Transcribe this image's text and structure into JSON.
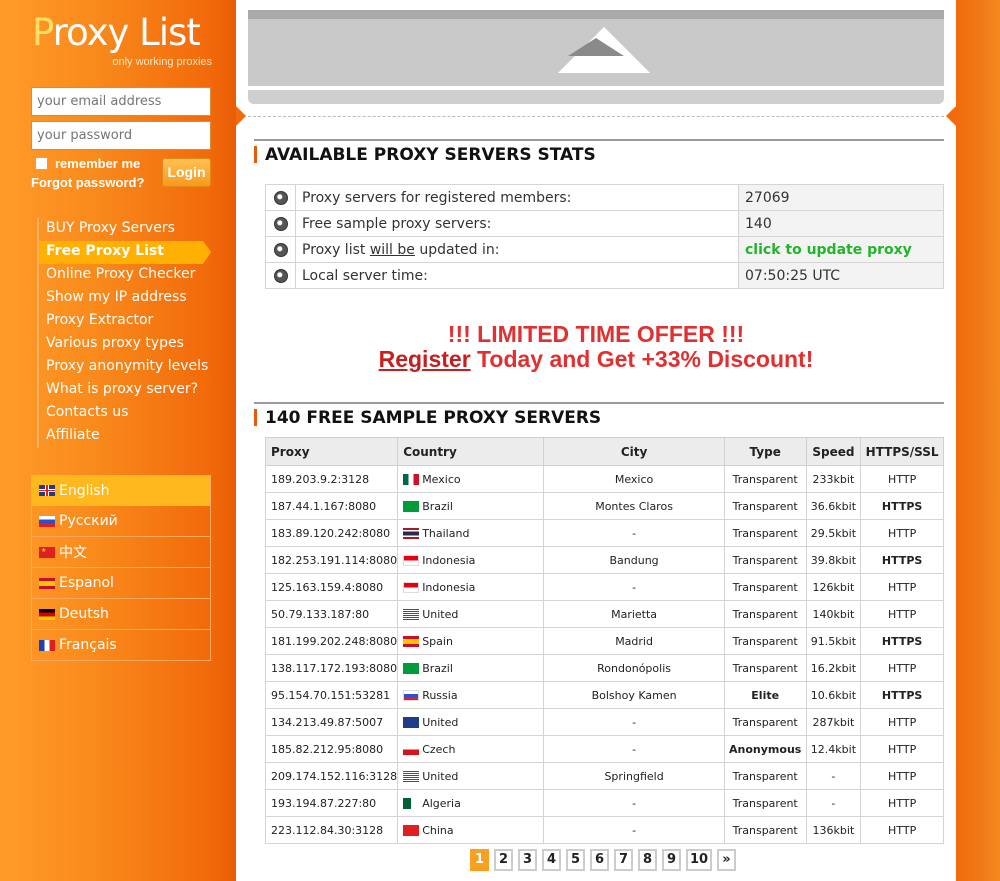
{
  "logo": {
    "first": "P",
    "rest": "roxy List",
    "tagline": "only working proxies"
  },
  "login": {
    "email_placeholder": "your email address",
    "password_placeholder": "your password",
    "remember": "remember me",
    "forgot": "Forgot password?",
    "login_label": "Login"
  },
  "nav": [
    "BUY Proxy Servers",
    "Free Proxy List",
    "Online Proxy Checker",
    "Show my IP address",
    "Proxy Extractor",
    "Various proxy types",
    "Proxy anonymity levels",
    "What is proxy server?",
    "Contacts us",
    "Affiliate"
  ],
  "languages": [
    "English",
    "Русский",
    "中文",
    "Espanol",
    "Deutsh",
    "Français"
  ],
  "stats": {
    "title": "AVAILABLE PROXY SERVERS STATS",
    "rows": [
      {
        "label": "Proxy servers for registered members:",
        "value": "27069"
      },
      {
        "label_pre": "Proxy list ",
        "label_u": "will be",
        "label_post": " updated in:",
        "value": "click to update proxy"
      },
      {
        "label": "Free sample proxy servers:",
        "value": "140"
      },
      {
        "label": "Local server time:",
        "value": "07:50:25 UTC"
      }
    ]
  },
  "offer": {
    "line1": "!!! LIMITED TIME OFFER !!!",
    "register": "Register",
    "line2_rest": " Today and Get +33% Discount!"
  },
  "proxies": {
    "title": "140 FREE SAMPLE PROXY SERVERS",
    "headers": [
      "Proxy",
      "Country",
      "City",
      "Type",
      "Speed",
      "HTTPS/SSL"
    ],
    "rows": [
      [
        "189.203.9.2:3128",
        "Mexico",
        "Mexico",
        "Transparent",
        "233kbit",
        "HTTP"
      ],
      [
        "187.44.1.167:8080",
        "Brazil",
        "Montes Claros",
        "Transparent",
        "36.6kbit",
        "HTTPS"
      ],
      [
        "183.89.120.242:8080",
        "Thailand",
        "-",
        "Transparent",
        "29.5kbit",
        "HTTP"
      ],
      [
        "182.253.191.114:8080",
        "Indonesia",
        "Bandung",
        "Transparent",
        "39.8kbit",
        "HTTPS"
      ],
      [
        "125.163.159.4:8080",
        "Indonesia",
        "-",
        "Transparent",
        "126kbit",
        "HTTP"
      ],
      [
        "50.79.133.187:80",
        "United",
        "Marietta",
        "Transparent",
        "140kbit",
        "HTTP"
      ],
      [
        "181.199.202.248:8080",
        "Spain",
        "Madrid",
        "Transparent",
        "91.5kbit",
        "HTTPS"
      ],
      [
        "138.117.172.193:8080",
        "Brazil",
        "Rondonópolis",
        "Transparent",
        "16.2kbit",
        "HTTP"
      ],
      [
        "95.154.70.151:53281",
        "Russia",
        "Bolshoy Kamen",
        "Elite",
        "10.6kbit",
        "HTTPS"
      ],
      [
        "134.213.49.87:5007",
        "United",
        "-",
        "Transparent",
        "287kbit",
        "HTTP"
      ],
      [
        "185.82.212.95:8080",
        "Czech",
        "-",
        "Anonymous",
        "12.4kbit",
        "HTTP"
      ],
      [
        "209.174.152.116:3128",
        "United",
        "Springfield",
        "Transparent",
        "-",
        "HTTP"
      ],
      [
        "193.194.87.227:80",
        "Algeria",
        "-",
        "Transparent",
        "-",
        "HTTP"
      ],
      [
        "223.112.84.30:3128",
        "China",
        "-",
        "Transparent",
        "136kbit",
        "HTTP"
      ]
    ]
  },
  "pager": [
    "1",
    "2",
    "3",
    "4",
    "5",
    "6",
    "7",
    "8",
    "9",
    "10",
    "»"
  ],
  "colors": {
    "accent": "#f47a14",
    "active_nav": "#ffb000",
    "offer": "#e03030",
    "green": "#22b52a"
  }
}
